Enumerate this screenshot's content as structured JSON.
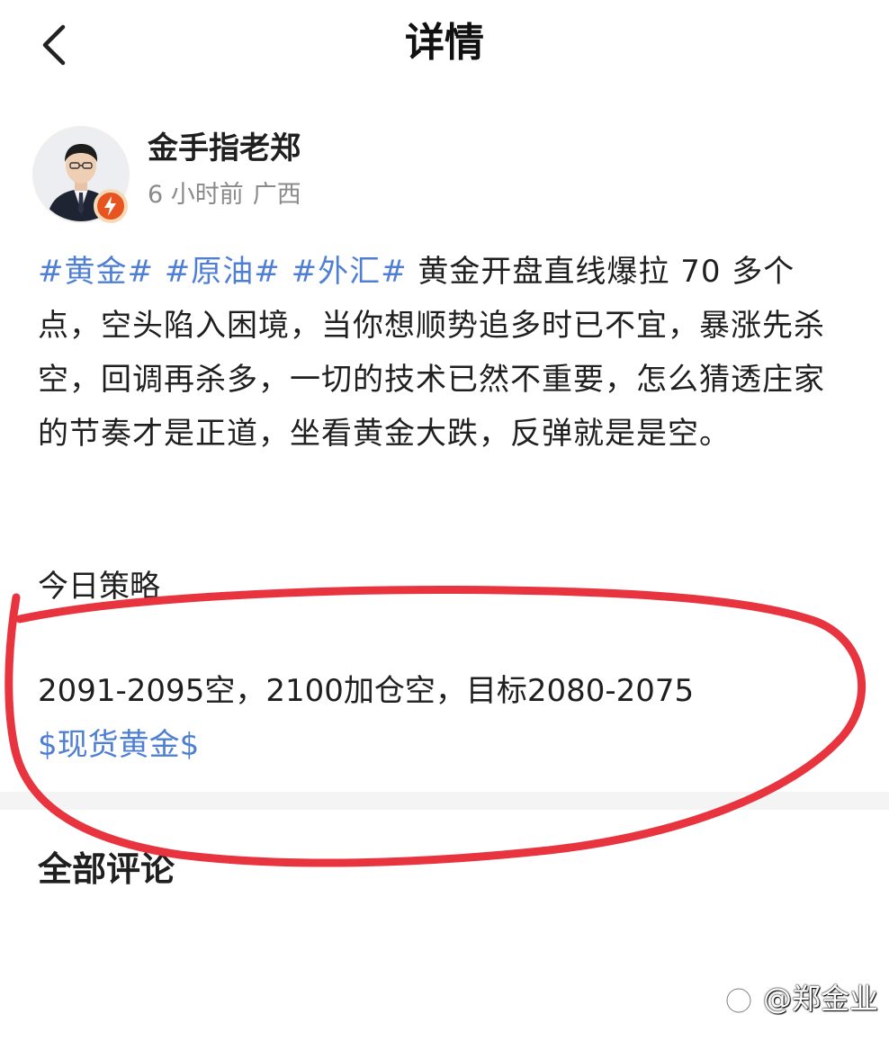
{
  "header": {
    "title": "详情",
    "back_icon": "chevron-left-icon"
  },
  "author": {
    "name": "金手指老郑",
    "time": "6 小时前",
    "location": "广西",
    "badge_icon": "lightning-badge-icon"
  },
  "post": {
    "hashtags": [
      "#黄金#",
      "#原油#",
      "#外汇#"
    ],
    "text": "黄金开盘直线爆拉 70 多个点，空头陷入困境，当你想顺势追多时已不宜，暴涨先杀空，回调再杀多，一切的技术已然不重要，怎么猜透庄家的节奏才是正道，坐看黄金大跌，反弹就是是空。"
  },
  "strategy": {
    "title": "今日策略",
    "text": "2091-2095空，2100加仓空，目标2080-2075",
    "stock_tag": "$现货黄金$"
  },
  "comments": {
    "title": "全部评论"
  },
  "watermark": {
    "text": "@郑金业"
  },
  "colors": {
    "link_blue": "#4f7fd3",
    "annotation_red": "#e8343f",
    "badge_orange": "#e8541f",
    "divider_gray": "#f4f4f5"
  }
}
